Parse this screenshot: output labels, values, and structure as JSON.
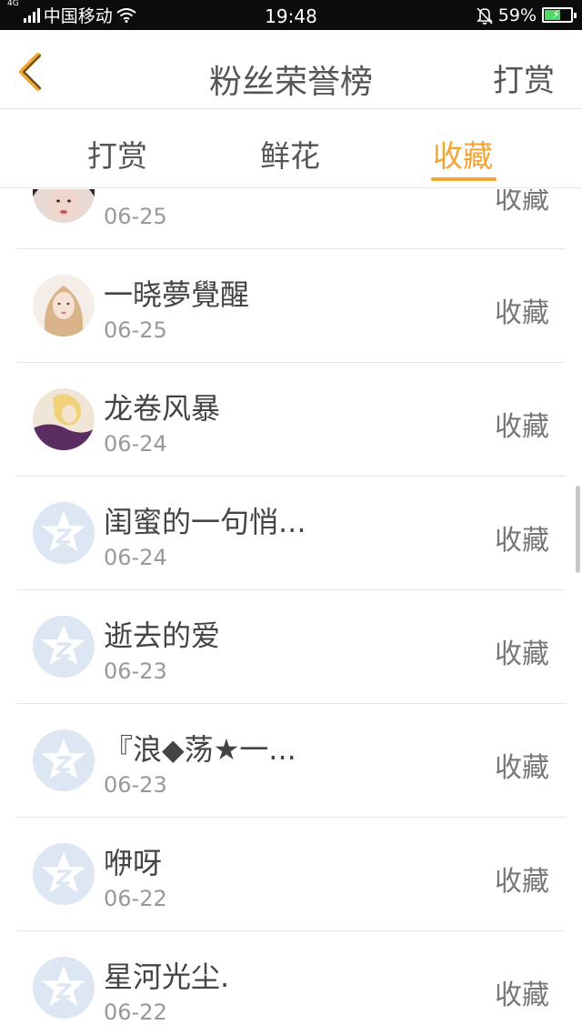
{
  "status_bar": {
    "network_tag": "4G",
    "carrier": "中国移动",
    "time": "19:48",
    "battery": "59%",
    "battery_level": 0.59,
    "icons": [
      "signal-icon",
      "wifi-icon",
      "bell-muted-icon",
      "battery-icon"
    ]
  },
  "header": {
    "back_icon": "chevron-left-icon",
    "title": "粉丝荣誉榜",
    "action": "打赏",
    "accent_color": "#f3a531"
  },
  "tabs": [
    {
      "label": "打赏",
      "active": false
    },
    {
      "label": "鲜花",
      "active": false
    },
    {
      "label": "收藏",
      "active": true
    }
  ],
  "list": [
    {
      "name": "",
      "date": "06-25",
      "action": "收藏",
      "avatar": "photo-avatar"
    },
    {
      "name": "一晓夢覺醒",
      "date": "06-25",
      "action": "收藏",
      "avatar": "photo-avatar"
    },
    {
      "name": "龙卷风暴",
      "date": "06-24",
      "action": "收藏",
      "avatar": "photo-avatar"
    },
    {
      "name": "闺蜜的一句悄...",
      "date": "06-24",
      "action": "收藏",
      "avatar": "default-star-avatar"
    },
    {
      "name": "逝去的爱",
      "date": "06-23",
      "action": "收藏",
      "avatar": "default-star-avatar"
    },
    {
      "name": "『浪◆荡★一...",
      "date": "06-23",
      "action": "收藏",
      "avatar": "default-star-avatar"
    },
    {
      "name": "咿呀",
      "date": "06-22",
      "action": "收藏",
      "avatar": "default-star-avatar"
    },
    {
      "name": "星河光尘.",
      "date": "06-22",
      "action": "收藏",
      "avatar": "default-star-avatar"
    }
  ]
}
